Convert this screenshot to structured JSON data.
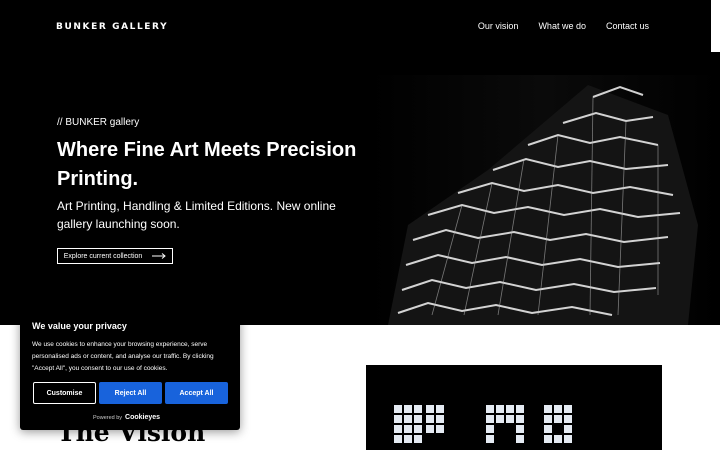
{
  "header": {
    "logo": "BUNKER GALLERY",
    "nav": [
      "Our vision",
      "What we do",
      "Contact us"
    ]
  },
  "hero": {
    "kicker": "// BUNKER gallery",
    "headline": "Where Fine Art Meets Precision Printing.",
    "subhead": "Art Printing, Handling & Limited Editions. New online gallery launching soon.",
    "cta_label": "Explore current collection"
  },
  "vision": {
    "title": "The Vision"
  },
  "cookie_banner": {
    "title": "We value your privacy",
    "body": "We use cookies to enhance your browsing experience, serve personalised ads or content, and analyse our traffic. By clicking \"Accept All\", you consent to our use of cookies.",
    "buttons": {
      "customise": "Customise",
      "reject": "Reject All",
      "accept": "Accept All"
    },
    "powered_by": "Powered by",
    "brand": "Cookieyes"
  },
  "colors": {
    "hero_bg": "#000000",
    "primary_button": "#1863dc",
    "text_on_dark": "#ffffff"
  },
  "icons": {
    "cta": "arrow-right-icon"
  }
}
